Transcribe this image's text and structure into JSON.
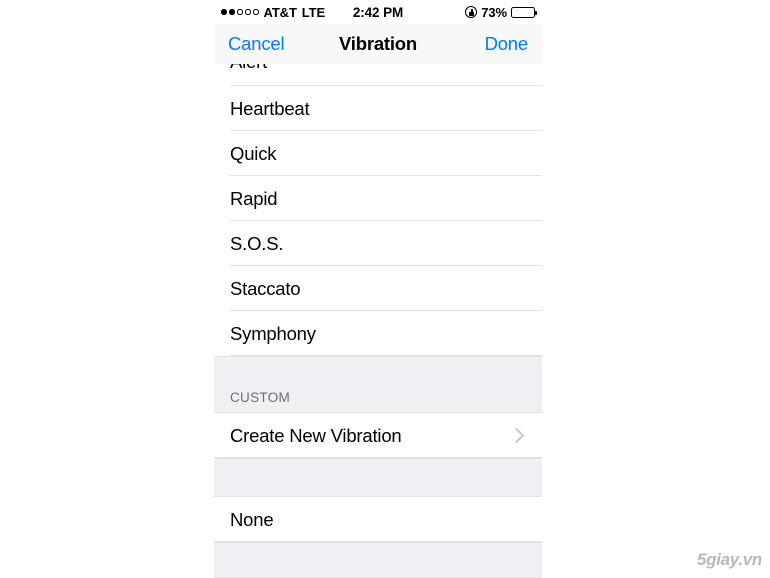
{
  "status_bar": {
    "signal_dots_total": 5,
    "signal_dots_filled": 2,
    "carrier": "AT&T",
    "network": "LTE",
    "time": "2:42 PM",
    "rotation_lock_icon": "rotation-lock-icon",
    "battery_percent_label": "73%",
    "battery_level": 73
  },
  "nav_bar": {
    "cancel_label": "Cancel",
    "title": "Vibration",
    "done_label": "Done",
    "accent_color": "#007aff"
  },
  "list": {
    "standard_items": [
      {
        "label": "Alert",
        "clipped": true
      },
      {
        "label": "Heartbeat",
        "clipped": false
      },
      {
        "label": "Quick",
        "clipped": false
      },
      {
        "label": "Rapid",
        "clipped": false
      },
      {
        "label": "S.O.S.",
        "clipped": false
      },
      {
        "label": "Staccato",
        "clipped": false
      },
      {
        "label": "Symphony",
        "clipped": false
      }
    ],
    "custom_section": {
      "header": "CUSTOM",
      "items": [
        {
          "label": "Create New Vibration",
          "accessory": "chevron-right-icon"
        }
      ]
    },
    "none_section": {
      "items": [
        {
          "label": "None"
        }
      ]
    }
  },
  "watermark": {
    "text": "5giay.vn"
  },
  "colors": {
    "accent": "#007aff",
    "group_background": "#efeff4",
    "separator": "#e2e2e5",
    "secondary_text": "#6d6d72",
    "chevron": "#c7c7cc"
  }
}
